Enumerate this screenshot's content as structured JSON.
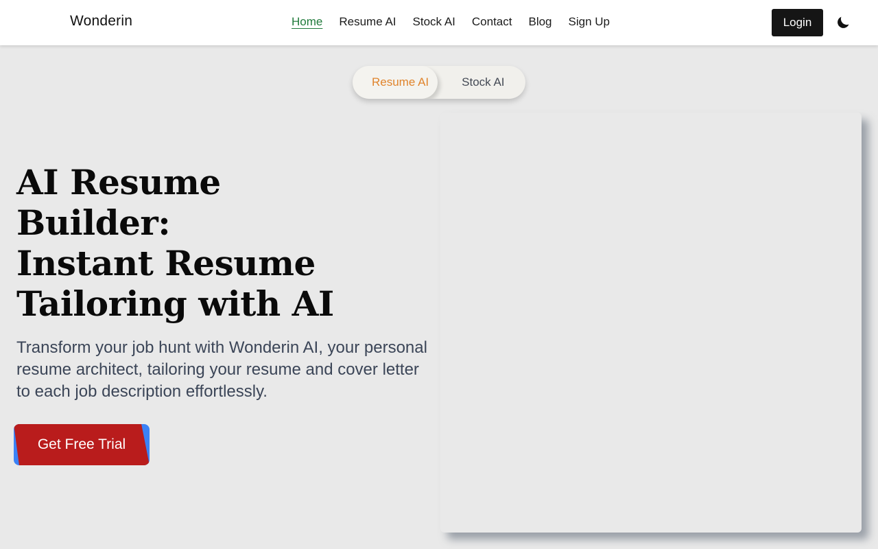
{
  "navbar": {
    "brand": "Wonderin",
    "links": [
      "Home",
      "Resume AI",
      "Stock AI",
      "Contact",
      "Blog",
      "Sign Up"
    ],
    "active_link": "Home",
    "login_label": "Login",
    "theme_icon": "moon-icon"
  },
  "toggle": {
    "options": [
      "Resume AI",
      "Stock AI"
    ],
    "active": "Resume AI"
  },
  "hero": {
    "headline_lines": [
      "AI Resume",
      "Builder:",
      "Instant Resume",
      "Tailoring with AI"
    ],
    "subtitle": "Transform your job hunt with Wonderin AI, your personal resume architect, tailoring your resume and cover letter to each job description effortlessly.",
    "cta_label": "Get Free Trial"
  },
  "colors": {
    "active_link": "#1f7a3a",
    "toggle_active": "#e0842c",
    "cta_bg": "#b91c1c",
    "cta_accent": "#3b82f6",
    "login_bg": "#151515",
    "background": "#e9e9e9"
  }
}
